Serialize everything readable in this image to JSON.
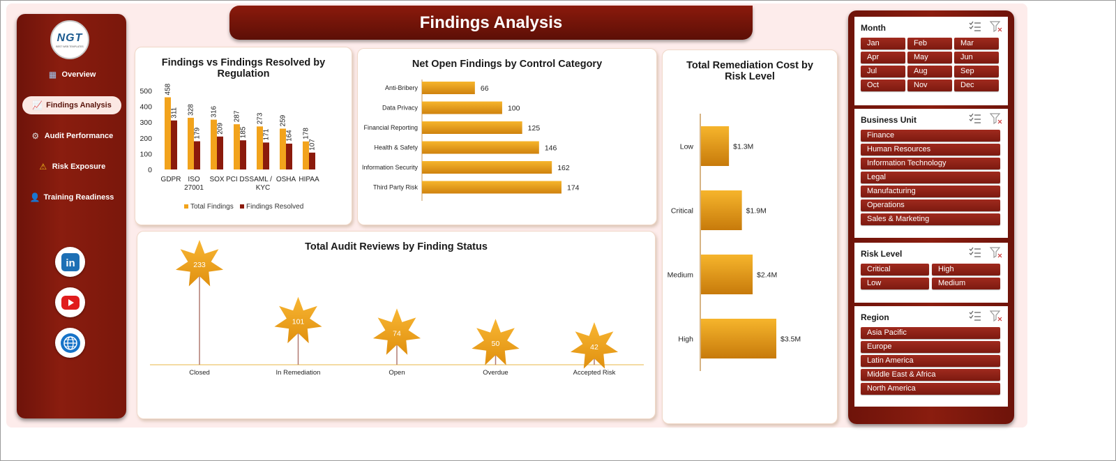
{
  "header": {
    "title": "Findings Analysis"
  },
  "logo": {
    "text": "NGT",
    "subtext": "BEST WEB TEMPLATES"
  },
  "nav": [
    {
      "label": "Overview",
      "icon": "dashboard-icon",
      "active": false
    },
    {
      "label": "Findings Analysis",
      "icon": "chart-icon",
      "active": true
    },
    {
      "label": "Audit Performance",
      "icon": "gear-icon",
      "active": false
    },
    {
      "label": "Risk Exposure",
      "icon": "warning-icon",
      "active": false
    },
    {
      "label": "Training Readiness",
      "icon": "person-icon",
      "active": false
    }
  ],
  "social": [
    {
      "name": "linkedin-icon",
      "glyph": "in"
    },
    {
      "name": "youtube-icon",
      "glyph": "▶"
    },
    {
      "name": "globe-icon",
      "glyph": "🌐"
    }
  ],
  "colors": {
    "accent_orange": "#f2a31c",
    "dark_red": "#8b1a0c",
    "sidebar": "#7a170b"
  },
  "chart_data": [
    {
      "type": "bar",
      "title": "Findings vs Findings Resolved by Regulation",
      "categories": [
        "GDPR",
        "ISO 27001",
        "SOX",
        "PCI DSS",
        "AML / KYC",
        "OSHA",
        "HIPAA"
      ],
      "series": [
        {
          "name": "Total Findings",
          "values": [
            458,
            328,
            316,
            287,
            273,
            259,
            178
          ],
          "color": "#f2a31c"
        },
        {
          "name": "Findings Resolved",
          "values": [
            311,
            179,
            209,
            185,
            171,
            164,
            107
          ],
          "color": "#8b1a0c"
        }
      ],
      "ylim": [
        0,
        500
      ],
      "yticks": [
        0,
        100,
        200,
        300,
        400,
        500
      ],
      "legend": "bottom"
    },
    {
      "type": "bar",
      "orientation": "horizontal",
      "title": "Net Open Findings by Control Category",
      "categories": [
        "Anti-Bribery",
        "Data Privacy",
        "Financial Reporting",
        "Health & Safety",
        "Information Security",
        "Third Party Risk"
      ],
      "values": [
        66,
        100,
        125,
        146,
        162,
        174
      ],
      "color": "#f2a31c"
    },
    {
      "type": "bar",
      "orientation": "horizontal",
      "title": "Total Remediation Cost by Risk Level",
      "categories": [
        "Low",
        "Critical",
        "Medium",
        "High"
      ],
      "values": [
        1.3,
        1.9,
        2.4,
        3.5
      ],
      "value_labels": [
        "$1.3M",
        "$1.9M",
        "$2.4M",
        "$3.5M"
      ],
      "color": "#f2a31c"
    },
    {
      "type": "lollipop",
      "title": "Total Audit Reviews by Finding Status",
      "categories": [
        "Closed",
        "In Remediation",
        "Open",
        "Overdue",
        "Accepted Risk"
      ],
      "values": [
        233,
        101,
        74,
        50,
        42
      ],
      "color": "#f2a31c"
    }
  ],
  "slicers": [
    {
      "title": "Month",
      "columns": 3,
      "items": [
        "Jan",
        "Feb",
        "Mar",
        "Apr",
        "May",
        "Jun",
        "Jul",
        "Aug",
        "Sep",
        "Oct",
        "Nov",
        "Dec"
      ]
    },
    {
      "title": "Business Unit",
      "columns": 1,
      "items": [
        "Finance",
        "Human Resources",
        "Information Technology",
        "Legal",
        "Manufacturing",
        "Operations",
        "Sales & Marketing"
      ]
    },
    {
      "title": "Risk Level",
      "columns": 2,
      "items": [
        "Critical",
        "High",
        "Low",
        "Medium"
      ]
    },
    {
      "title": "Region",
      "columns": 1,
      "items": [
        "Asia Pacific",
        "Europe",
        "Latin America",
        "Middle East & Africa",
        "North America"
      ]
    }
  ]
}
